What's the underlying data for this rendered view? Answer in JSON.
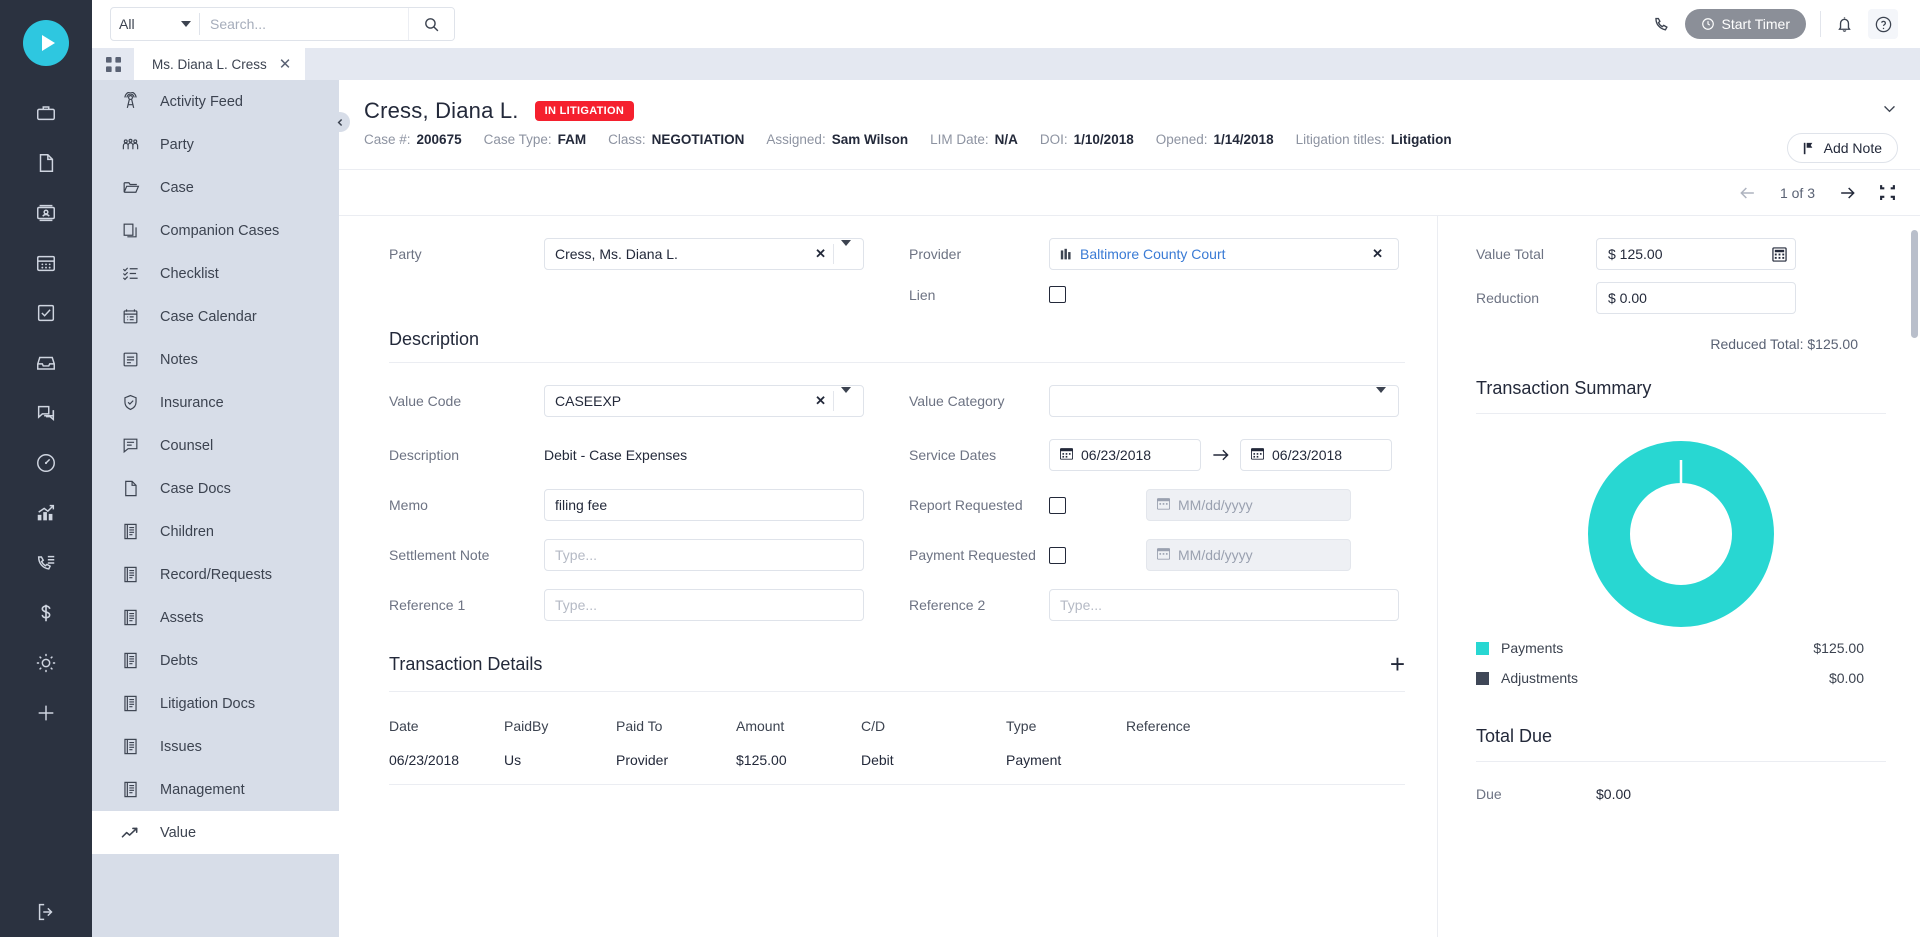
{
  "search": {
    "scope": "All",
    "placeholder": "Search...",
    "value": ""
  },
  "topbar": {
    "timer_label": "Start Timer",
    "phone_icon": "phone-icon",
    "bell_icon": "bell-icon",
    "help_icon": "help-icon"
  },
  "tabstrip": {
    "grid_icon": "grid-icon",
    "tab_label": "Ms. Diana L. Cress",
    "close_icon": "close-icon"
  },
  "rail": {
    "logo_icon": "play-logo-icon",
    "items": [
      "briefcase-icon",
      "document-icon",
      "contact-card-icon",
      "calendar-icon",
      "checkbox-icon",
      "inbox-icon",
      "chat-icon",
      "speedometer-icon",
      "growth-chart-icon",
      "phone-list-icon",
      "dollar-icon",
      "gear-icon",
      "plus-icon"
    ],
    "logout_icon": "logout-icon"
  },
  "sidebar": {
    "items": [
      {
        "label": "Activity Feed",
        "icon": "broadcast-icon",
        "active": false
      },
      {
        "label": "Party",
        "icon": "people-icon",
        "active": false
      },
      {
        "label": "Case",
        "icon": "folder-open-icon",
        "active": false
      },
      {
        "label": "Companion Cases",
        "icon": "copy-icon",
        "active": false
      },
      {
        "label": "Checklist",
        "icon": "checklist-icon",
        "active": false
      },
      {
        "label": "Case Calendar",
        "icon": "calendar-list-icon",
        "active": false
      },
      {
        "label": "Notes",
        "icon": "note-icon",
        "active": false
      },
      {
        "label": "Insurance",
        "icon": "shield-check-icon",
        "active": false
      },
      {
        "label": "Counsel",
        "icon": "comment-lines-icon",
        "active": false
      },
      {
        "label": "Case Docs",
        "icon": "file-icon",
        "active": false
      },
      {
        "label": "Children",
        "icon": "book-icon",
        "active": false
      },
      {
        "label": "Record/Requests",
        "icon": "book-icon",
        "active": false
      },
      {
        "label": "Assets",
        "icon": "book-icon",
        "active": false
      },
      {
        "label": "Debts",
        "icon": "book-icon",
        "active": false
      },
      {
        "label": "Litigation Docs",
        "icon": "book-icon",
        "active": false
      },
      {
        "label": "Issues",
        "icon": "book-icon",
        "active": false
      },
      {
        "label": "Management",
        "icon": "book-icon",
        "active": false
      },
      {
        "label": "Value",
        "icon": "trend-up-icon",
        "active": true
      }
    ]
  },
  "case_header": {
    "title": "Cress, Diana L.",
    "status_badge": "IN LITIGATION",
    "meta": [
      {
        "key": "Case #:",
        "value": "200675"
      },
      {
        "key": "Case Type:",
        "value": "FAM"
      },
      {
        "key": "Class:",
        "value": "NEGOTIATION"
      },
      {
        "key": "Assigned:",
        "value": "Sam Wilson"
      },
      {
        "key": "LIM Date:",
        "value": "N/A"
      },
      {
        "key": "DOI:",
        "value": "1/10/2018"
      },
      {
        "key": "Opened:",
        "value": "1/14/2018"
      },
      {
        "key": "Litigation titles:",
        "value": "Litigation"
      }
    ],
    "add_note_label": "Add Note",
    "collapse_icon": "chevron-down-icon"
  },
  "pager": {
    "prev_icon": "arrow-left-icon",
    "count_label": "1 of 3",
    "next_icon": "arrow-right-icon",
    "expand_icon": "collapse-icon"
  },
  "form": {
    "party": {
      "label": "Party",
      "value": "Cress, Ms. Diana L."
    },
    "provider": {
      "label": "Provider",
      "value": "Baltimore County Court",
      "icon": "building-icon"
    },
    "lien": {
      "label": "Lien",
      "checked": false
    },
    "description_section": "Description",
    "value_code": {
      "label": "Value Code",
      "value": "CASEEXP"
    },
    "value_category": {
      "label": "Value Category",
      "value": ""
    },
    "description": {
      "label": "Description",
      "value": "Debit - Case Expenses"
    },
    "service_dates": {
      "label": "Service Dates",
      "from": "06/23/2018",
      "to": "06/23/2018"
    },
    "memo": {
      "label": "Memo",
      "value": "filing fee"
    },
    "report_requested": {
      "label": "Report Requested",
      "checked": false,
      "date_placeholder": "MM/dd/yyyy"
    },
    "settlement_note": {
      "label": "Settlement Note",
      "value": "",
      "placeholder": "Type..."
    },
    "payment_requested": {
      "label": "Payment Requested",
      "checked": false,
      "date_placeholder": "MM/dd/yyyy"
    },
    "reference1": {
      "label": "Reference 1",
      "value": "",
      "placeholder": "Type..."
    },
    "reference2": {
      "label": "Reference 2",
      "value": "",
      "placeholder": "Type..."
    }
  },
  "transaction_details": {
    "title": "Transaction Details",
    "add_icon": "plus-icon",
    "columns": [
      "Date",
      "PaidBy",
      "Paid To",
      "Amount",
      "C/D",
      "Type",
      "Reference"
    ],
    "rows": [
      [
        "06/23/2018",
        "Us",
        "Provider",
        "$125.00",
        "Debit",
        "Payment",
        ""
      ]
    ]
  },
  "right_panel": {
    "value_total": {
      "label": "Value Total",
      "value": "$ 125.00",
      "calc_icon": "calculator-icon"
    },
    "reduction": {
      "label": "Reduction",
      "value": "$ 0.00"
    },
    "reduced_total": "Reduced Total: $125.00",
    "summary_title": "Transaction Summary",
    "total_due_title": "Total Due",
    "due": {
      "label": "Due",
      "value": "$0.00"
    }
  },
  "chart_data": {
    "type": "pie",
    "title": "Transaction Summary",
    "categories": [
      "Payments",
      "Adjustments"
    ],
    "values": [
      125.0,
      0.0
    ],
    "value_labels": [
      "$125.00",
      "$0.00"
    ],
    "colors": [
      "#28d7d2",
      "#3f4757"
    ],
    "donut": true,
    "inner_radius_ratio": 0.56,
    "legend_position": "bottom"
  },
  "colors": {
    "accent_teal": "#28d7d2",
    "rail_dark": "#2b3240",
    "sidebar_bg": "#d7dde8",
    "badge_red": "#f5202e",
    "link_blue": "#3a7bd5"
  }
}
